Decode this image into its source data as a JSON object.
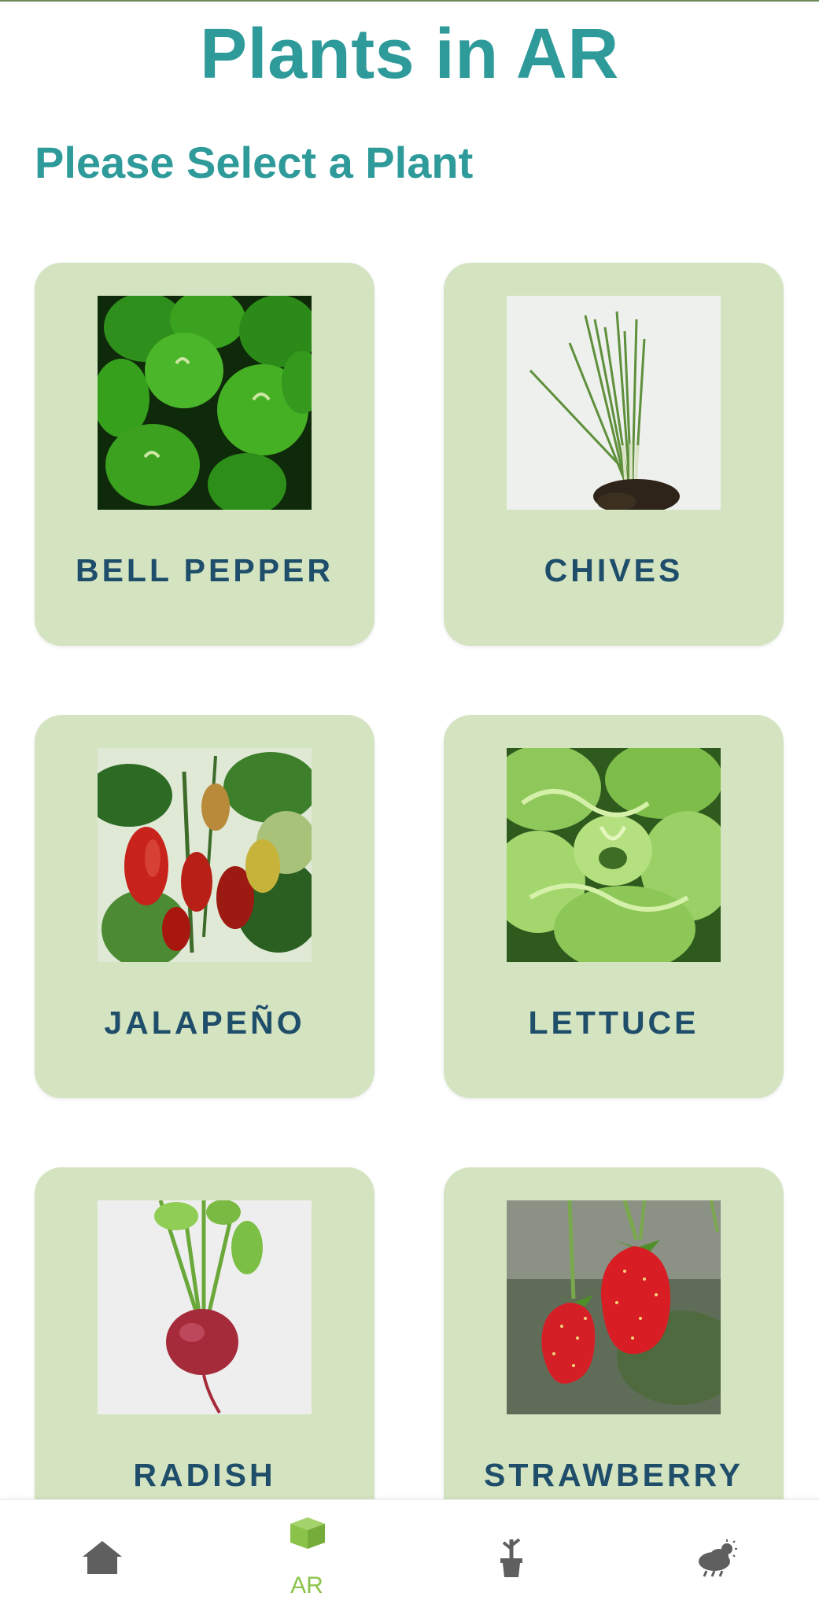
{
  "header": {
    "title": "Plants in AR",
    "subtitle": "Please Select a Plant"
  },
  "plants": [
    {
      "label": "BELL PEPPER",
      "image_icon": "bell-pepper-photo"
    },
    {
      "label": "CHIVES",
      "image_icon": "chives-photo"
    },
    {
      "label": "JALAPEÑO",
      "image_icon": "jalapeno-photo"
    },
    {
      "label": "LETTUCE",
      "image_icon": "lettuce-photo"
    },
    {
      "label": "RADISH",
      "image_icon": "radish-photo"
    },
    {
      "label": "STRAWBERRY",
      "image_icon": "strawberry-photo"
    }
  ],
  "bottom_nav": {
    "items": [
      {
        "icon": "home-icon",
        "label": "",
        "active": false
      },
      {
        "icon": "ar-cube-icon",
        "label": "AR",
        "active": true
      },
      {
        "icon": "plant-pot-icon",
        "label": "",
        "active": false
      },
      {
        "icon": "weather-icon",
        "label": "",
        "active": false
      }
    ]
  },
  "colors": {
    "title": "#2e9a9a",
    "card_background": "#d4e4c1",
    "card_label": "#1f4e6b",
    "nav_active": "#8bc34a",
    "nav_inactive": "#5f5f5f"
  }
}
